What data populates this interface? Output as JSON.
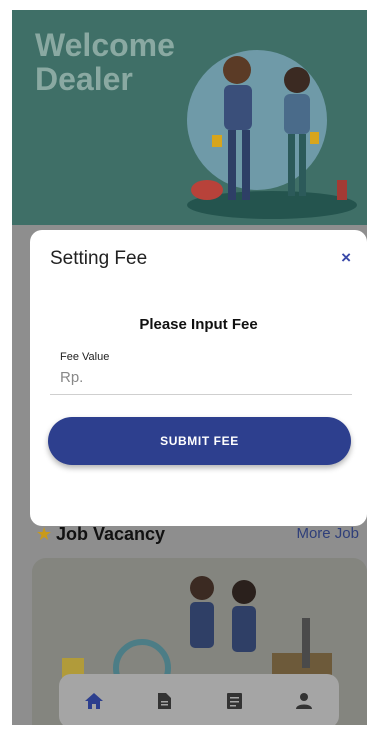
{
  "header": {
    "welcome_text": "Welcome\nDealer"
  },
  "modal": {
    "title": "Setting Fee",
    "close_label": "×",
    "subtitle": "Please Input Fee",
    "field_label": "Fee Value",
    "field_placeholder": "Rp.",
    "submit_label": "SUBMIT FEE"
  },
  "job_section": {
    "title": "Job Vacancy",
    "more_label": "More Job",
    "star_icon": "star-icon"
  },
  "bottom_nav": {
    "items": [
      {
        "icon": "home-icon",
        "active": true
      },
      {
        "icon": "document-icon",
        "active": false
      },
      {
        "icon": "list-document-icon",
        "active": false
      },
      {
        "icon": "person-icon",
        "active": false
      }
    ]
  },
  "colors": {
    "accent": "#2d3f8e",
    "hero_bg": "#3f6f67",
    "star": "#c99a1a"
  }
}
